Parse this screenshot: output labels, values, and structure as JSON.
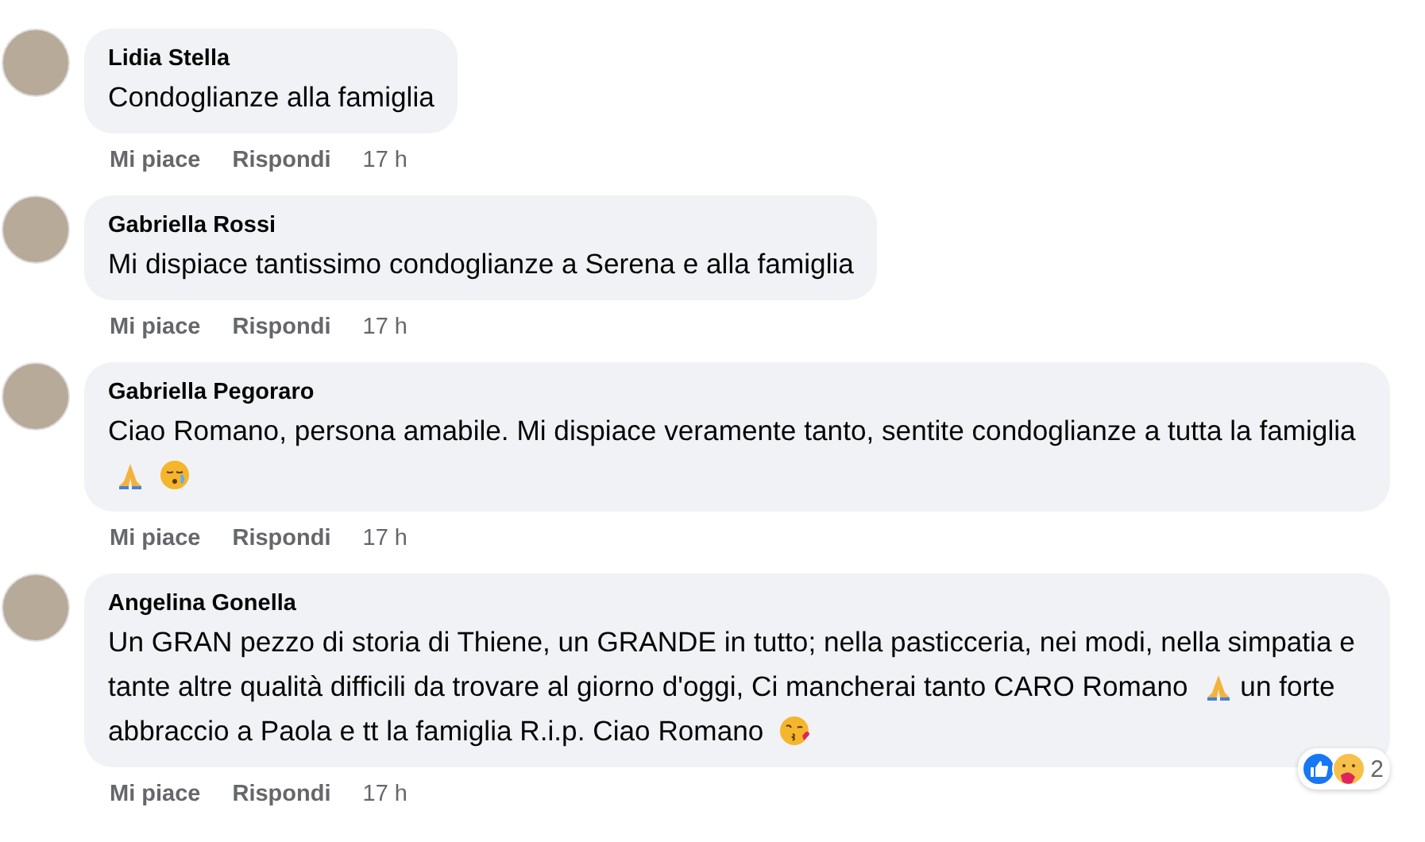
{
  "comments": [
    {
      "author": "Lidia Stella",
      "parts": [
        {
          "kind": "text",
          "text": "Condoglianze alla famiglia"
        }
      ],
      "actions": {
        "like": "Mi piace",
        "reply": "Rispondi",
        "time": "17 h"
      }
    },
    {
      "author": "Gabriella Rossi",
      "parts": [
        {
          "kind": "text",
          "text": "Mi dispiace tantissimo condoglianze a Serena e alla famiglia"
        }
      ],
      "actions": {
        "like": "Mi piace",
        "reply": "Rispondi",
        "time": "17 h"
      }
    },
    {
      "author": "Gabriella Pegoraro",
      "parts": [
        {
          "kind": "text",
          "text": "Ciao Romano, persona amabile. Mi dispiace veramente tanto, sentite condoglianze a tutta la famiglia"
        },
        {
          "kind": "pray"
        },
        {
          "kind": "sad"
        }
      ],
      "actions": {
        "like": "Mi piace",
        "reply": "Rispondi",
        "time": "17 h"
      }
    },
    {
      "author": "Angelina Gonella",
      "parts": [
        {
          "kind": "text",
          "text": "Un GRAN pezzo di storia di Thiene, un GRANDE in tutto; nella pasticceria, nei modi, nella simpatia e tante altre qualità difficili da trovare al giorno d'oggi, Ci mancherai tanto CARO Romano"
        },
        {
          "kind": "pray"
        },
        {
          "kind": "text",
          "text": "un forte abbraccio a Paola e tt la famiglia R.i.p. Ciao Romano"
        },
        {
          "kind": "kiss"
        }
      ],
      "reactions": {
        "icons": [
          {
            "kind": "like"
          },
          {
            "kind": "care"
          }
        ],
        "count": "2"
      },
      "actions": {
        "like": "Mi piace",
        "reply": "Rispondi",
        "time": "17 h"
      }
    }
  ]
}
